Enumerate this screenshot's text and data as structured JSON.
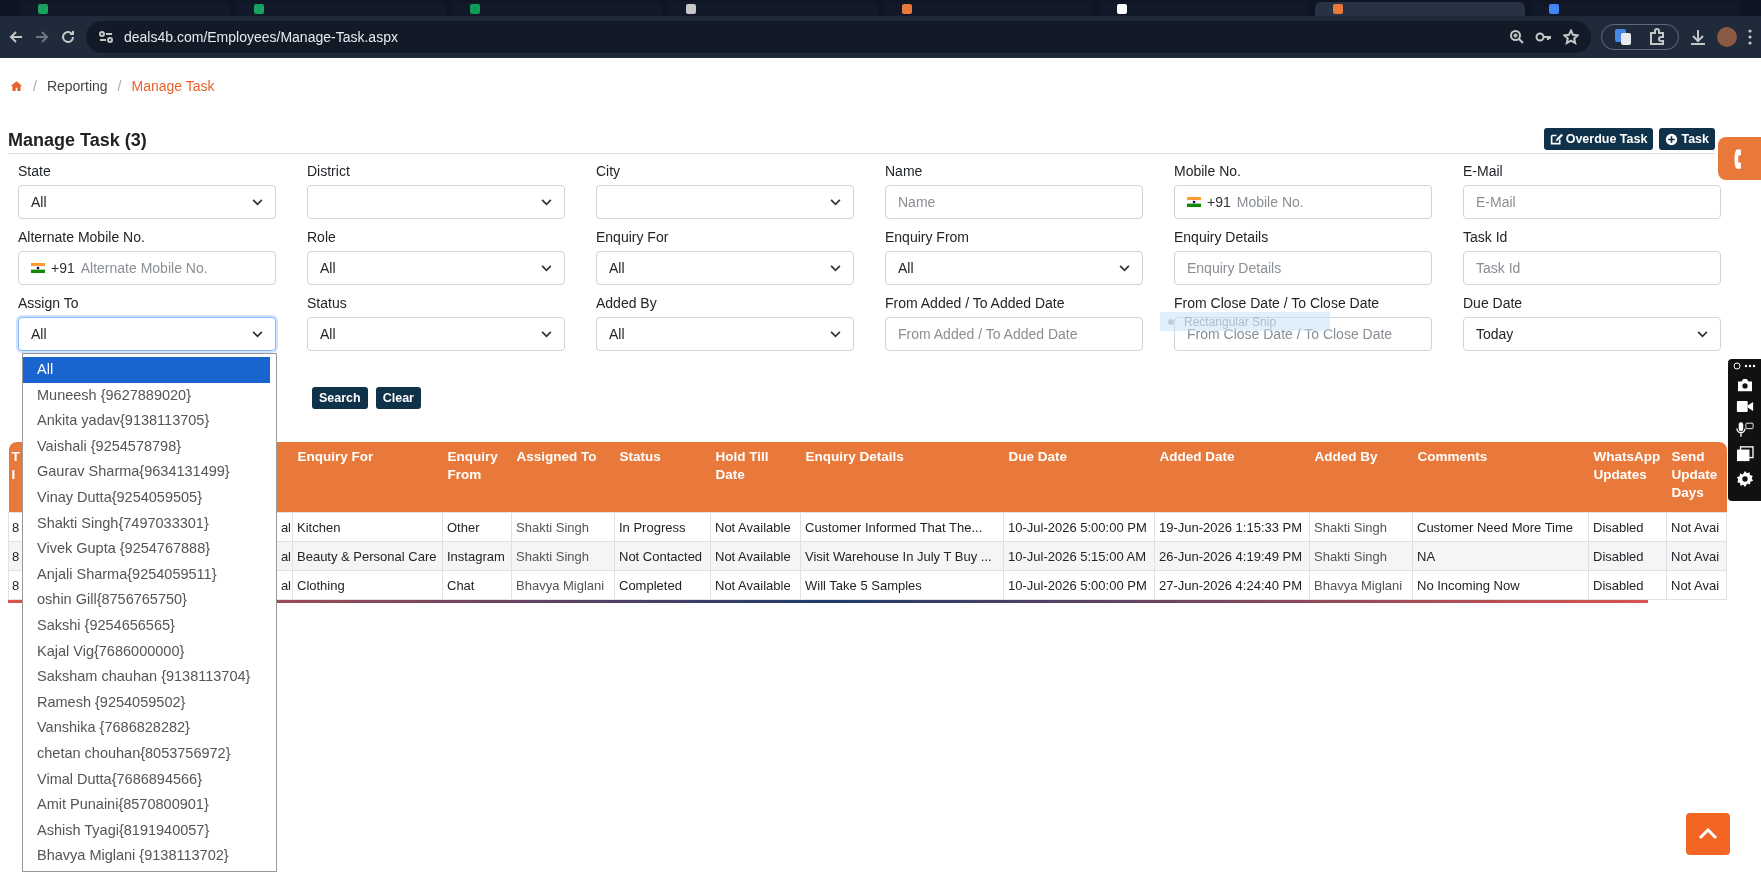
{
  "browser": {
    "url": "deals4b.com/Employees/Manage-Task.aspx",
    "tabs": [
      {
        "selected": false
      },
      {
        "selected": false
      },
      {
        "selected": false
      },
      {
        "selected": false
      },
      {
        "selected": false
      },
      {
        "selected": false
      },
      {
        "selected": true
      },
      {
        "selected": false
      }
    ]
  },
  "breadcrumb": {
    "separator": "/",
    "items": [
      {
        "label": "Reporting",
        "current": false
      },
      {
        "label": "Manage Task",
        "current": true
      }
    ]
  },
  "page_title": "Manage Task (3)",
  "header_buttons": [
    {
      "label": "Overdue Task"
    },
    {
      "label": "Task"
    }
  ],
  "filters": [
    {
      "label": "State",
      "kind": "select",
      "value": "All",
      "focused": false
    },
    {
      "label": "District",
      "kind": "select",
      "focused": false
    },
    {
      "label": "City",
      "kind": "select",
      "focused": false
    },
    {
      "label": "Name",
      "kind": "input",
      "placeholder": "Name",
      "focused": false
    },
    {
      "label": "Mobile No.",
      "kind": "phone",
      "code": "+91",
      "placeholder": "Mobile No.",
      "focused": false
    },
    {
      "label": "E-Mail",
      "kind": "input",
      "placeholder": "E-Mail",
      "focused": false
    },
    {
      "label": "Alternate Mobile No.",
      "kind": "phone",
      "code": "+91",
      "placeholder": "Alternate Mobile No.",
      "focused": false
    },
    {
      "label": "Role",
      "kind": "select",
      "value": "All",
      "focused": false
    },
    {
      "label": "Enquiry For",
      "kind": "select",
      "value": "All",
      "focused": false
    },
    {
      "label": "Enquiry From",
      "kind": "select",
      "value": "All",
      "focused": false
    },
    {
      "label": "Enquiry Details",
      "kind": "input",
      "placeholder": "Enquiry Details",
      "focused": false
    },
    {
      "label": "Task Id",
      "kind": "input",
      "placeholder": "Task Id",
      "focused": false
    },
    {
      "label": "Assign To",
      "kind": "select",
      "value": "All",
      "focused": true
    },
    {
      "label": "Status",
      "kind": "select",
      "value": "All",
      "focused": false
    },
    {
      "label": "Added By",
      "kind": "select",
      "value": "All",
      "focused": false
    },
    {
      "label": "From Added / To Added Date",
      "kind": "input",
      "placeholder": "From Added / To Added Date",
      "focused": false
    },
    {
      "label": "From Close Date / To Close Date",
      "kind": "input",
      "placeholder": "From Close Date / To Close Date",
      "focused": false
    },
    {
      "label": "Due Date",
      "kind": "select",
      "value": "Today",
      "focused": false
    }
  ],
  "dropdown_options": [
    {
      "label": "All",
      "selected": true
    },
    {
      "label": "Muneesh {9627889020}",
      "selected": false
    },
    {
      "label": "Ankita yadav{9138113705}",
      "selected": false
    },
    {
      "label": "Vaishali {9254578798}",
      "selected": false
    },
    {
      "label": "Gaurav Sharma{9634131499}",
      "selected": false
    },
    {
      "label": "Vinay Dutta{9254059505}",
      "selected": false
    },
    {
      "label": "Shakti Singh{7497033301}",
      "selected": false
    },
    {
      "label": "Vivek Gupta {9254767888}",
      "selected": false
    },
    {
      "label": "Anjali Sharma{9254059511}",
      "selected": false
    },
    {
      "label": "oshin Gill{8756765750}",
      "selected": false
    },
    {
      "label": "Sakshi {9254656565}",
      "selected": false
    },
    {
      "label": "Kajal Vig{7686000000}",
      "selected": false
    },
    {
      "label": "Saksham chauhan {9138113704}",
      "selected": false
    },
    {
      "label": "Ramesh {9254059502}",
      "selected": false
    },
    {
      "label": "Vanshika {7686828282}",
      "selected": false
    },
    {
      "label": "chetan chouhan{8053756972}",
      "selected": false
    },
    {
      "label": "Vimal Dutta{7686894566}",
      "selected": false
    },
    {
      "label": "Amit Punaini{8570800901}",
      "selected": false
    },
    {
      "label": "Ashish Tyagi{8191940057}",
      "selected": false
    },
    {
      "label": "Bhavya Miglani {9138113702}",
      "selected": false
    }
  ],
  "actions": [
    "Search",
    "Clear"
  ],
  "snip_tooltip": "Rectangular Snip",
  "table": {
    "columns": [
      {
        "header": "T I",
        "muted": false
      },
      {
        "muted": false
      },
      {
        "header": "Enquiry For",
        "muted": false
      },
      {
        "header": "Enquiry From",
        "muted": false
      },
      {
        "header": "Assigned To",
        "muted": true
      },
      {
        "header": "Status",
        "muted": false
      },
      {
        "header": "Hold Till Date",
        "muted": false
      },
      {
        "header": "Enquiry Details",
        "muted": false
      },
      {
        "header": "Due Date",
        "muted": false
      },
      {
        "header": "Added Date",
        "muted": false
      },
      {
        "header": "Added By",
        "muted": true
      },
      {
        "header": "Comments",
        "muted": false
      },
      {
        "header": "WhatsApp Updates",
        "muted": false
      },
      {
        "header": "Send Update Days",
        "muted": false
      }
    ],
    "rows": [
      [
        "8",
        "al",
        "Kitchen",
        "Other",
        "Shakti Singh",
        "In Progress",
        "Not Available",
        "Customer Informed That The...",
        "10-Jul-2026 5:00:00 PM",
        "19-Jun-2026 1:15:33 PM",
        "Shakti Singh",
        "Customer Need More Time",
        "Disabled",
        "Not Avai"
      ],
      [
        "8",
        "al",
        "Beauty & Personal Care",
        "Instagram",
        "Shakti Singh",
        "Not Contacted",
        "Not Available",
        "Visit Warehouse In July T Buy ...",
        "10-Jul-2026 5:15:00 AM",
        "26-Jun-2026 4:19:49 PM",
        "Shakti Singh",
        "NA",
        "Disabled",
        "Not Avai"
      ],
      [
        "8",
        "al",
        "Clothing",
        "Chat",
        "Bhavya Miglani",
        "Completed",
        "Not Available",
        "Will Take 5 Samples",
        "10-Jul-2026 5:00:00 PM",
        "27-Jun-2026 4:24:40 PM",
        "Bhavya Miglani",
        "No Incoming Now",
        "Disabled",
        "Not Avai"
      ]
    ]
  }
}
